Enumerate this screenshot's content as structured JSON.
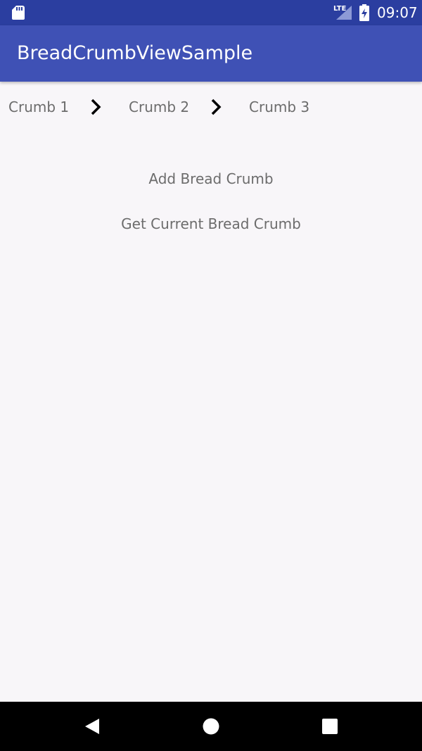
{
  "status_bar": {
    "network_label": "LTE",
    "time": "09:07",
    "icons": [
      "sd-card-icon",
      "signal-icon",
      "battery-charging-icon"
    ]
  },
  "app_bar": {
    "title": "BreadCrumbViewSample"
  },
  "breadcrumb": {
    "items": [
      {
        "label": "Crumb 1"
      },
      {
        "label": "Crumb 2"
      },
      {
        "label": "Crumb 3"
      }
    ],
    "separator_icon": "chevron-right-icon"
  },
  "actions": {
    "add_label": "Add Bread Crumb",
    "get_current_label": "Get Current Bread Crumb"
  },
  "nav_bar": {
    "icons": [
      "back-icon",
      "home-icon",
      "recents-icon"
    ]
  },
  "colors": {
    "status_bar": "#2b3ea0",
    "app_bar": "#3f51b5",
    "background": "#f8f6f9",
    "text_secondary": "#6c6c6c",
    "nav_bar": "#000000"
  }
}
